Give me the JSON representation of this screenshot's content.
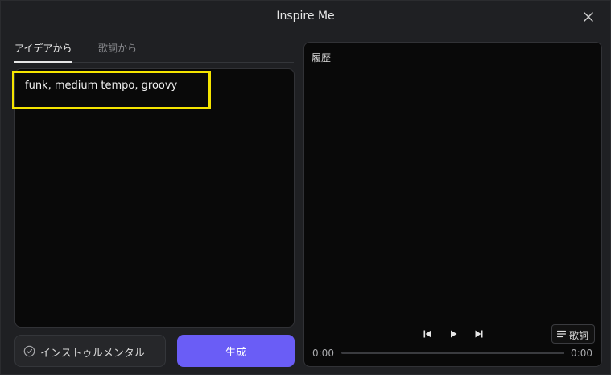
{
  "dialog": {
    "title": "Inspire Me"
  },
  "tabs": [
    {
      "label": "アイデアから",
      "active": true
    },
    {
      "label": "歌詞から",
      "active": false
    }
  ],
  "editor": {
    "text": "funk, medium tempo, groovy"
  },
  "actions": {
    "instrumental_label": "インストゥルメンタル",
    "generate_label": "生成"
  },
  "history": {
    "title": "履歴",
    "lyrics_label": "歌詞",
    "time_current": "0:00",
    "time_total": "0:00",
    "progress": 0
  },
  "icons": [
    "close-icon",
    "check-circle-icon",
    "skip-previous-icon",
    "play-icon",
    "skip-next-icon",
    "lines-icon"
  ],
  "colors": {
    "accent": "#6a5df6",
    "highlight": "#f4e400"
  }
}
